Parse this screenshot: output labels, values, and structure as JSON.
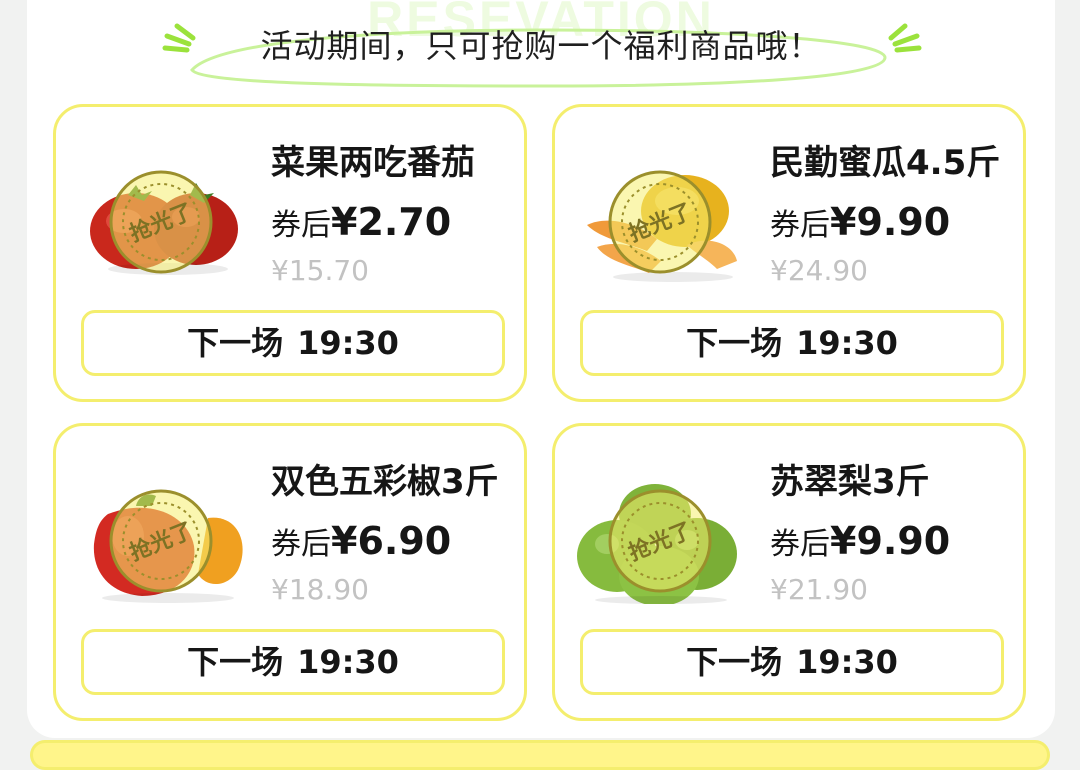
{
  "notice": "活动期间，只可抢购一个福利商品哦！",
  "watermark": "RESEVATION",
  "stamp_text": "抢光了",
  "colors": {
    "card_border": "#f4ee6e",
    "accent_green": "#9be23c",
    "original_price": "#c2c2c2"
  },
  "products": [
    {
      "name": "菜果两吃番茄",
      "price_prefix": "券后",
      "price": "¥2.70",
      "original_price": "¥15.70",
      "button_prefix": "下一场",
      "button_time": "19:30",
      "image": "tomato-image",
      "status": "sold-out"
    },
    {
      "name": "民勤蜜瓜4.5斤",
      "price_prefix": "券后",
      "price": "¥9.90",
      "original_price": "¥24.90",
      "button_prefix": "下一场",
      "button_time": "19:30",
      "image": "melon-image",
      "status": "sold-out"
    },
    {
      "name": "双色五彩椒3斤",
      "price_prefix": "券后",
      "price": "¥6.90",
      "original_price": "¥18.90",
      "button_prefix": "下一场",
      "button_time": "19:30",
      "image": "pepper-image",
      "status": "sold-out"
    },
    {
      "name": "苏翠梨3斤",
      "price_prefix": "券后",
      "price": "¥9.90",
      "original_price": "¥21.90",
      "button_prefix": "下一场",
      "button_time": "19:30",
      "image": "pear-image",
      "status": "sold-out"
    }
  ]
}
